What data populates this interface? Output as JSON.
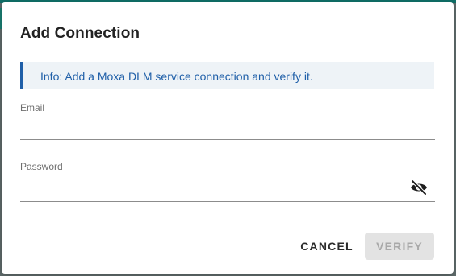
{
  "dialog": {
    "title": "Add Connection",
    "info": "Info: Add a Moxa DLM service connection and verify it."
  },
  "form": {
    "email": {
      "label": "Email",
      "value": "",
      "placeholder": ""
    },
    "password": {
      "label": "Password",
      "value": "",
      "placeholder": "",
      "visibility_icon": "eye-off-icon"
    }
  },
  "actions": {
    "cancel_label": "CANCEL",
    "verify_label": "VERIFY",
    "verify_disabled": true
  },
  "colors": {
    "accent": "#0f6f67",
    "info_text": "#1f5fa8",
    "info_background": "#eef3f7",
    "disabled_button": "#e3e3e3"
  }
}
